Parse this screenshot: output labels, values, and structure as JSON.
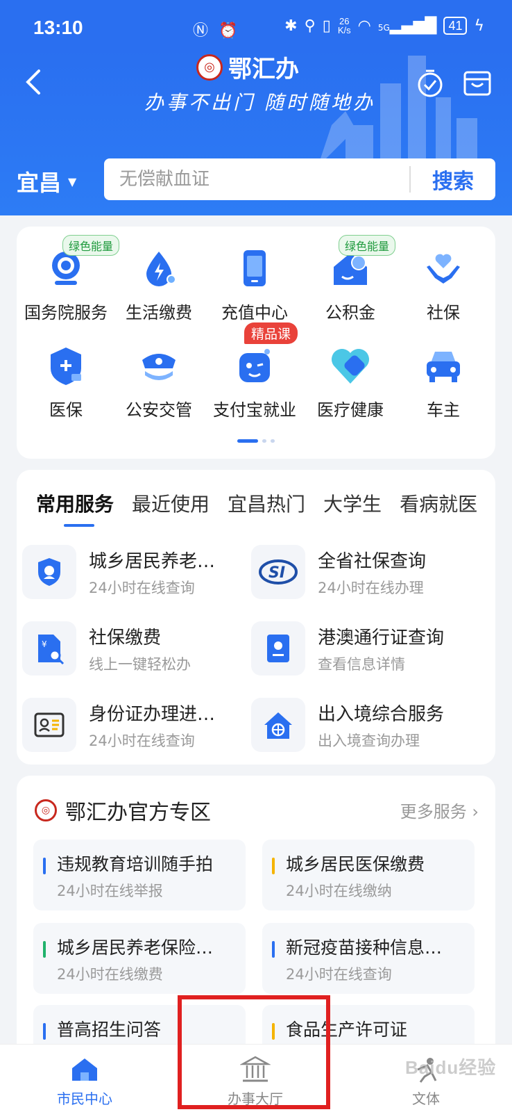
{
  "status_bar": {
    "time": "13:10",
    "network_speed": "26",
    "network_speed_unit": "K/s",
    "signal_label": "5G",
    "battery": "41"
  },
  "header": {
    "app_name": "鄂汇办",
    "slogan": "办事不出门 随时随地办",
    "city": "宜昌",
    "search_placeholder": "无偿献血证",
    "search_button": "搜索"
  },
  "grid": {
    "items": [
      {
        "label": "国务院服务",
        "tag": "绿色能量",
        "icon": "state-council-icon"
      },
      {
        "label": "生活缴费",
        "tag": "",
        "icon": "utility-payment-icon"
      },
      {
        "label": "充值中心",
        "tag": "",
        "icon": "recharge-phone-icon"
      },
      {
        "label": "公积金",
        "tag": "绿色能量",
        "icon": "housing-fund-icon"
      },
      {
        "label": "社保",
        "tag": "",
        "icon": "social-security-hands-icon"
      },
      {
        "label": "医保",
        "tag": "",
        "icon": "medical-insurance-shield-icon"
      },
      {
        "label": "公安交管",
        "tag": "",
        "icon": "police-cap-icon"
      },
      {
        "label": "支付宝就业",
        "tag": "精品课",
        "icon": "robot-face-icon"
      },
      {
        "label": "医疗健康",
        "tag": "",
        "icon": "health-heart-icon"
      },
      {
        "label": "车主",
        "tag": "",
        "icon": "car-icon"
      }
    ]
  },
  "services": {
    "tabs": [
      "常用服务",
      "最近使用",
      "宜昌热门",
      "大学生",
      "看病就医"
    ],
    "items": [
      {
        "title": "城乡居民养老…",
        "subtitle": "24小时在线查询",
        "icon": "pension-shield-icon"
      },
      {
        "title": "全省社保查询",
        "subtitle": "24小时在线办理",
        "icon": "si-logo-icon"
      },
      {
        "title": "社保缴费",
        "subtitle": "线上一键轻松办",
        "icon": "payment-search-document-icon"
      },
      {
        "title": "港澳通行证查询",
        "subtitle": "查看信息详情",
        "icon": "passport-icon"
      },
      {
        "title": "身份证办理进…",
        "subtitle": "24小时在线查询",
        "icon": "id-card-icon"
      },
      {
        "title": "出入境综合服务",
        "subtitle": "出入境查询办理",
        "icon": "globe-house-icon"
      }
    ]
  },
  "official_zone": {
    "title": "鄂汇办官方专区",
    "more": "更多服务",
    "items": [
      {
        "title": "违规教育培训随手拍",
        "subtitle": "24小时在线举报",
        "color": "#2a6ff0"
      },
      {
        "title": "城乡居民医保缴费",
        "subtitle": "24小时在线缴纳",
        "color": "#f5b400"
      },
      {
        "title": "城乡居民养老保险…",
        "subtitle": "24小时在线缴费",
        "color": "#20b26b"
      },
      {
        "title": "新冠疫苗接种信息…",
        "subtitle": "24小时在线查询",
        "color": "#2a6ff0"
      },
      {
        "title": "普高招生问答",
        "subtitle": "",
        "color": "#2a6ff0"
      },
      {
        "title": "食品生产许可证",
        "subtitle": "",
        "color": "#f5b400"
      }
    ]
  },
  "bottom_nav": {
    "items": [
      {
        "label": "市民中心",
        "icon": "home-icon",
        "active": true
      },
      {
        "label": "办事大厅",
        "icon": "government-hall-icon",
        "active": false
      },
      {
        "label": "文体",
        "icon": "sports-icon",
        "active": false
      }
    ]
  },
  "watermark": "Baidu经验",
  "colors": {
    "primary": "#2a6ff0",
    "highlight": "#e02020"
  }
}
